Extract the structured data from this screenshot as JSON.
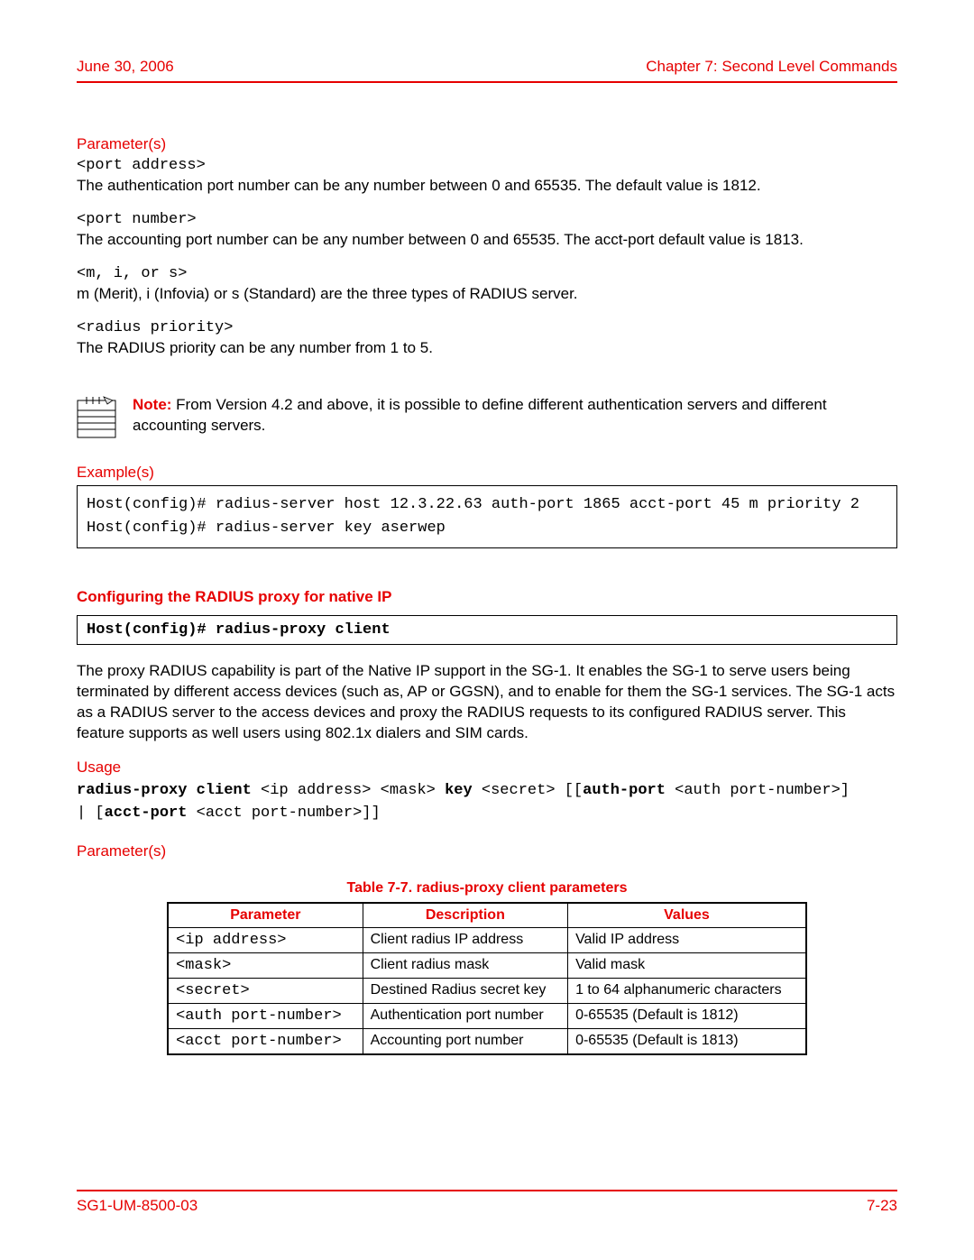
{
  "header": {
    "date": "June 30, 2006",
    "chapter": "Chapter 7: Second Level Commands"
  },
  "sections": {
    "parameters_label": "Parameter(s)",
    "examples_label": "Example(s)",
    "usage_label": "Usage",
    "parameters2_label": "Parameter(s)"
  },
  "params": [
    {
      "code": "<port address>",
      "desc": "The authentication port number can be any number between 0 and 65535. The default value is 1812."
    },
    {
      "code": "<port number>",
      "desc": "The accounting port number can be any number between 0 and 65535. The acct-port default value is 1813."
    },
    {
      "code": "<m, i, or s>",
      "desc": "m (Merit), i (Infovia) or s (Standard) are the three types of RADIUS server."
    },
    {
      "code": "<radius priority>",
      "desc": "The RADIUS priority can be any number from 1 to 5."
    }
  ],
  "note": {
    "label": "Note:",
    "text": " From Version 4.2 and above, it is possible to define different authentication servers and different accounting servers."
  },
  "example_lines": "Host(config)# radius-server host 12.3.22.63 auth-port 1865 acct-port 45 m priority 2\nHost(config)# radius-server key aserwep",
  "subheading": "Configuring the RADIUS proxy for native IP",
  "command": "Host(config)# radius-proxy client",
  "proxy_desc": "The proxy RADIUS capability is part of the Native IP support in the SG-1. It enables the SG-1 to serve users being terminated by different access devices (such as, AP or GGSN), and to enable for them the SG-1 services. The SG-1 acts as a RADIUS server to the access devices and proxy the RADIUS requests to its configured RADIUS server. This feature supports as well users using 802.1x dialers and SIM cards.",
  "usage": {
    "b1": "radius-proxy client",
    "t1": " <ip address> <mask> ",
    "b2": "key",
    "t2": " <secret> [[",
    "b3": "auth-port",
    "t3": " <auth port-number>]",
    "line2_pre": "| [",
    "b4": "acct-port",
    "t4": " <acct port-number>]]"
  },
  "table": {
    "caption": "Table 7-7. radius-proxy client parameters",
    "headers": {
      "p": "Parameter",
      "d": "Description",
      "v": "Values"
    },
    "rows": [
      {
        "p": "<ip address>",
        "d": "Client radius IP address",
        "v": "Valid IP address"
      },
      {
        "p": "<mask>",
        "d": "Client radius mask",
        "v": "Valid mask"
      },
      {
        "p": "<secret>",
        "d": "Destined Radius secret key",
        "v": "1 to 64 alphanumeric characters"
      },
      {
        "p": "<auth port-number>",
        "d": "Authentication port number",
        "v": "0-65535 (Default is 1812)"
      },
      {
        "p": "<acct port-number>",
        "d": "Accounting port number",
        "v": "0-65535 (Default is 1813)"
      }
    ]
  },
  "footer": {
    "doc_id": "SG1-UM-8500-03",
    "page_num": "7-23"
  }
}
